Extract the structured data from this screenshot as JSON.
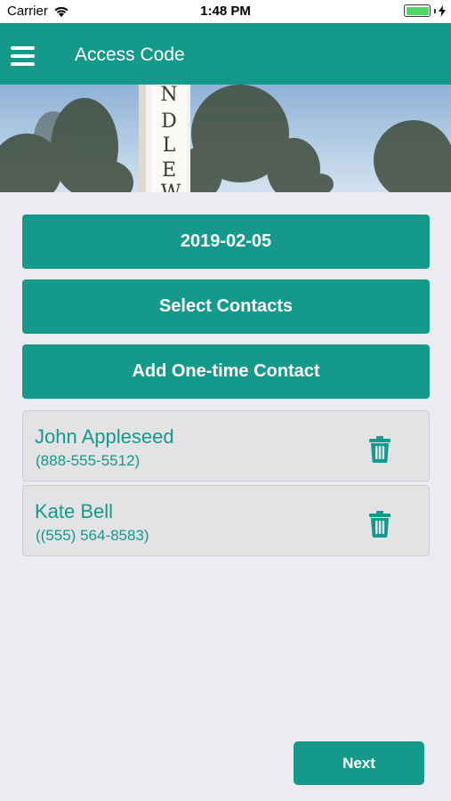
{
  "status_bar": {
    "carrier": "Carrier",
    "time": "1:48 PM",
    "battery_level": 1.0,
    "battery_color": "#4cd964"
  },
  "nav": {
    "title": "Access Code",
    "menu_icon": "hamburger-menu-icon",
    "bar_color": "#14998a"
  },
  "hero": {
    "sign_letters": [
      "N",
      "D",
      "L",
      "E",
      "W"
    ]
  },
  "actions": {
    "date_label": "2019-02-05",
    "select_contacts_label": "Select Contacts",
    "add_contact_label": "Add One-time Contact"
  },
  "contacts": [
    {
      "name": "John Appleseed",
      "phone": "(888-555-5512)",
      "delete_icon": "trash-icon"
    },
    {
      "name": "Kate Bell",
      "phone": "((555) 564-8583)",
      "delete_icon": "trash-icon"
    }
  ],
  "footer": {
    "next_label": "Next"
  },
  "accent_color": "#14998a",
  "background_color": "#ebebf0"
}
